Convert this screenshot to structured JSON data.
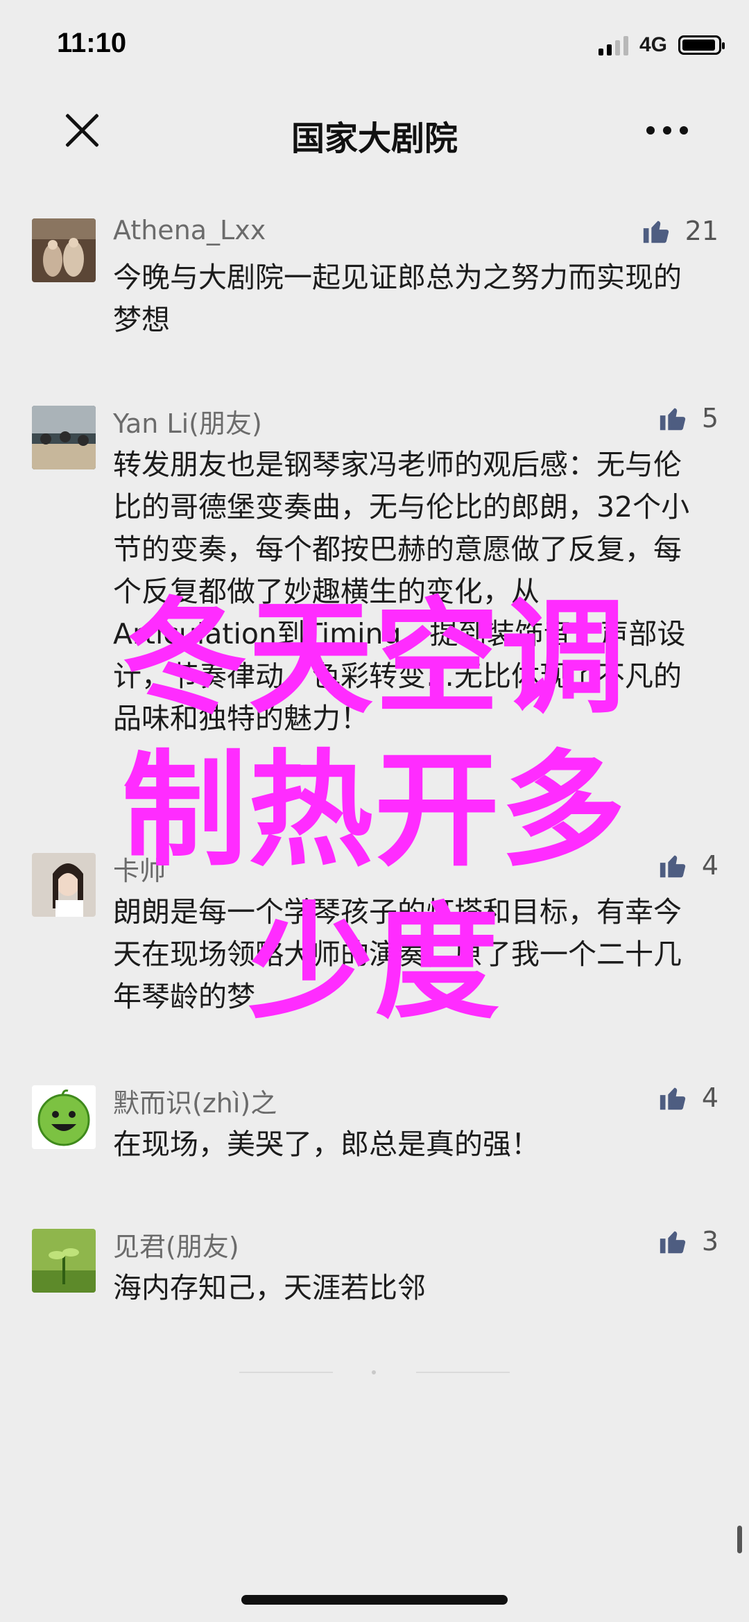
{
  "status": {
    "time": "11:10",
    "network": "4G"
  },
  "nav": {
    "title": "国家大剧院"
  },
  "comments": [
    {
      "name": "Athena_Lxx",
      "text": "今晚与大剧院一起见证郎总为之努力而实现的梦想",
      "likes": "21"
    },
    {
      "name": "Yan Li(朋友)",
      "text": "转发朋友也是钢琴家冯老师的观后感：无与伦比的哥德堡变奏曲，无与伦比的郎朗，32个小节的变奏，每个都按巴赫的意愿做了反复，每个反复都做了妙趣横生的变化，从Articulation到Timing，提到装饰音，声部设计，节奏律动，色彩转变…无比体现了不凡的品味和独特的魅力！",
      "likes": "5"
    },
    {
      "name": "卡帅",
      "text": "朗朗是每一个学琴孩子的灯塔和目标，有幸今天在现场领略大师的演奏，原了我一个二十几年琴龄的梦",
      "likes": "4"
    },
    {
      "name": "默而识(zhì)之",
      "text": "在现场，美哭了，郎总是真的强！",
      "likes": "4"
    },
    {
      "name": "见君(朋友)",
      "text": "海内存知己，天涯若比邻",
      "likes": "3"
    }
  ],
  "overlay": {
    "line1": "冬天空调",
    "line2": "制热开多",
    "line3": "少度",
    "color": "#ff2cff"
  },
  "icons": {
    "close": "close-icon",
    "more": "more-icon",
    "like": "thumbs-up-icon"
  }
}
